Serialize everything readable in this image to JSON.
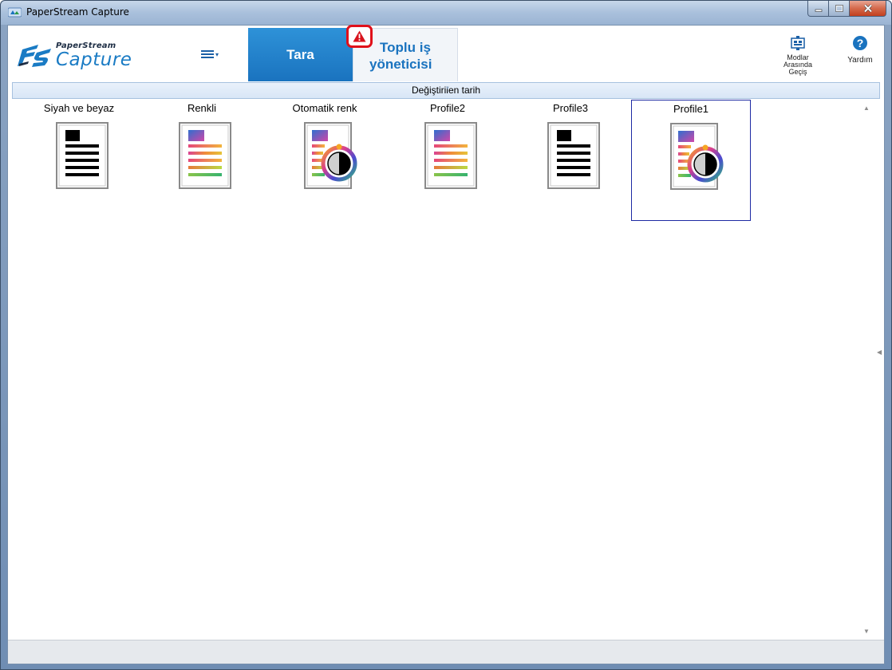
{
  "window": {
    "title": "PaperStream Capture",
    "controls": {
      "minimize_icon": "minimize-icon",
      "maximize_icon": "maximize-icon",
      "close_icon": "close-icon"
    }
  },
  "header": {
    "logo": {
      "top_text": "PaperStream",
      "main_text": "Capture"
    },
    "menu_icon": "hamburger-menu-icon",
    "tabs": [
      {
        "label": "Tara",
        "active": true
      },
      {
        "label_line1": "Toplu iş",
        "label_line2": "yöneticisi",
        "active": false,
        "warning_icon": "warning-icon"
      }
    ],
    "tools": [
      {
        "label_lines": [
          "Modlar",
          "Arasında",
          "Geçiş"
        ],
        "icon": "switch-modes-icon"
      },
      {
        "label": "Yardım",
        "icon": "help-icon"
      }
    ]
  },
  "sort": {
    "label": "Değiştirilen tarih"
  },
  "profiles": [
    {
      "name": "Siyah ve beyaz",
      "icon": "black-white-document-icon"
    },
    {
      "name": "Renkli",
      "icon": "color-document-icon"
    },
    {
      "name": "Otomatik renk",
      "icon": "auto-color-document-icon"
    },
    {
      "name": "Profile2",
      "icon": "color-document-icon"
    },
    {
      "name": "Profile3",
      "icon": "black-white-document-icon"
    },
    {
      "name": "Profile1",
      "icon": "auto-color-document-icon",
      "selected": true
    }
  ],
  "colors": {
    "accent": "#1a73bf",
    "warning": "#e0101a",
    "selection_border": "#1d2aa3"
  }
}
